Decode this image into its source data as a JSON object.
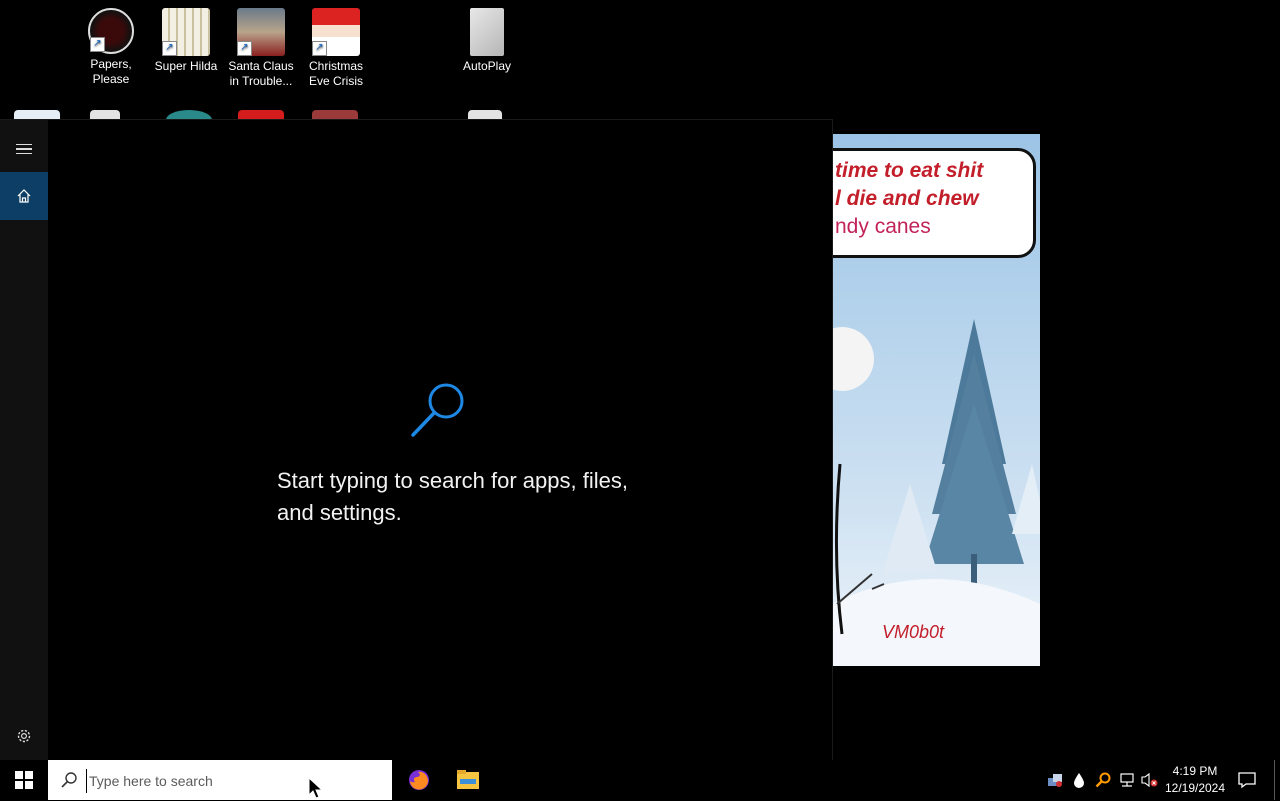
{
  "desktop": {
    "icons": [
      {
        "label": "Papers, Please",
        "icon": "papers-please-icon"
      },
      {
        "label": "Super Hilda",
        "icon": "super-hilda-icon"
      },
      {
        "label": "Santa Claus in Trouble...",
        "icon": "santa-claus-icon"
      },
      {
        "label": "Christmas Eve Crisis",
        "icon": "christmas-eve-crisis-icon"
      },
      {
        "label": "AutoPlay",
        "icon": "autoplay-icon"
      }
    ]
  },
  "start": {
    "search_prompt": "Start typing to search for apps, files, and settings.",
    "accent": "#0078d7"
  },
  "wallpaper": {
    "line1": "time to eat shit",
    "line2": "l die and chew",
    "line3": "ndy canes",
    "signature": "VM0b0t"
  },
  "taskbar": {
    "search_placeholder": "Type here to search",
    "pinned": [
      {
        "name": "firefox-icon"
      },
      {
        "name": "file-explorer-icon"
      }
    ],
    "tray": [
      "network-adapter-icon",
      "water-drop-icon",
      "search-tool-icon",
      "network-icon",
      "volume-muted-icon"
    ],
    "time": "4:19 PM",
    "date": "12/19/2024"
  }
}
